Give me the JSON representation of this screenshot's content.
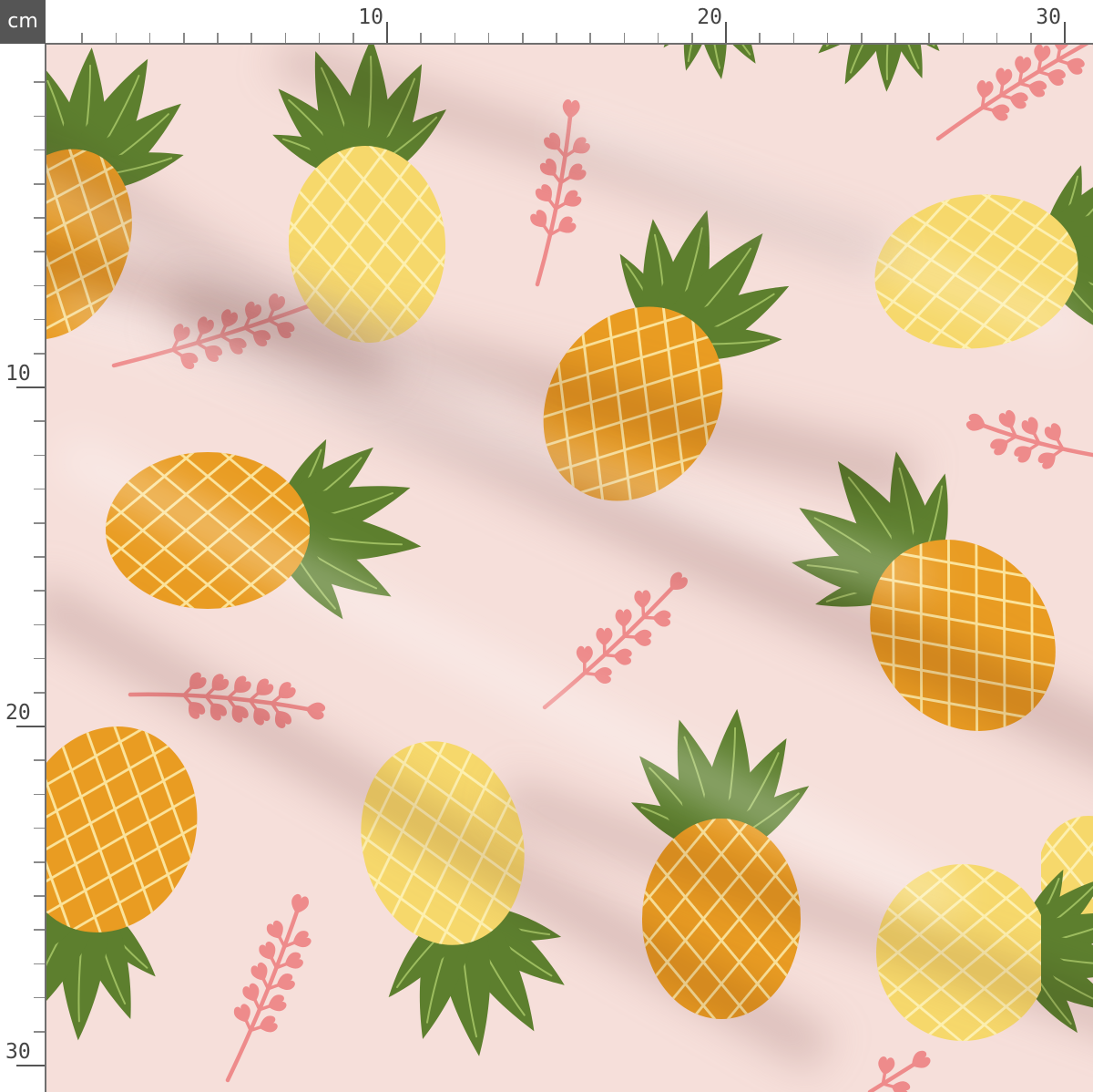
{
  "ruler": {
    "unit_label": "cm",
    "top_labels": [
      "10",
      "20",
      "30"
    ],
    "left_labels": [
      "10",
      "20",
      "30"
    ]
  },
  "fabric": {
    "background_color": "#f6dfda",
    "motif_icons": [
      "pineapple-icon",
      "pink-sprig-icon"
    ]
  },
  "colors": {
    "ruler_unit_box": "#555555",
    "pineapple_orange": "#e99c22",
    "pineapple_yellow": "#f6d86b",
    "hatch_orange": "#fbe39a",
    "hatch_yellow": "#fdf0b0",
    "leaf_green": "#5d7f2e",
    "leaf_vein": "#9dbd5f",
    "sprig_pink": "#ee8b8b"
  }
}
